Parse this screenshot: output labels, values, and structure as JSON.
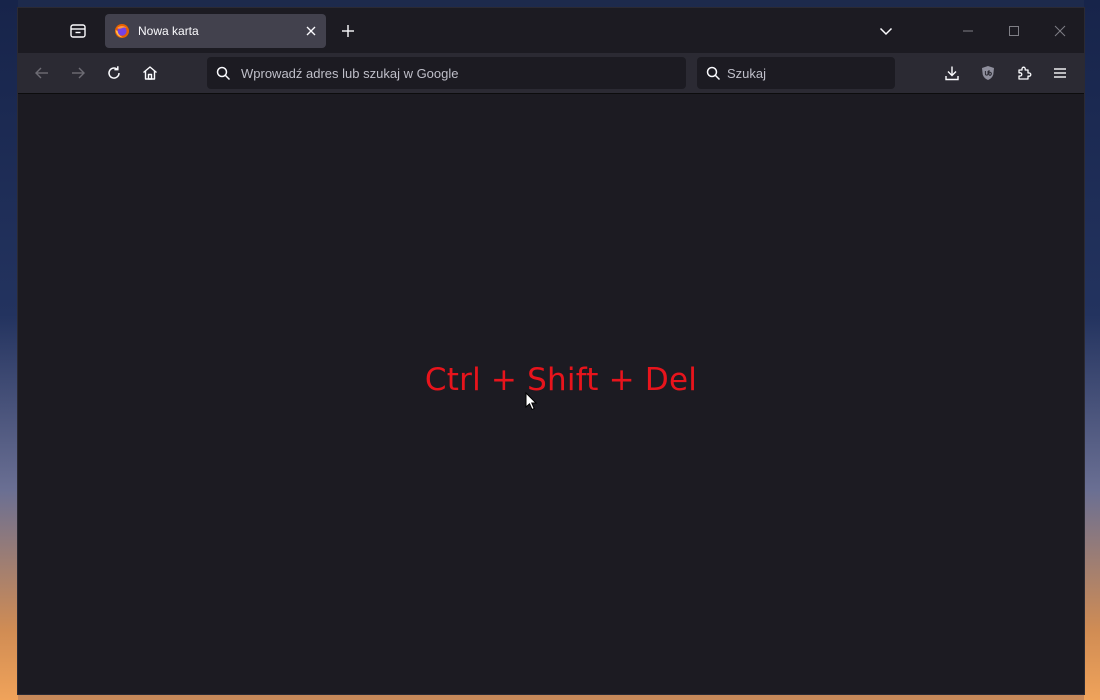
{
  "browser": {
    "tab": {
      "title": "Nowa karta"
    },
    "urlbar": {
      "placeholder": "Wprowadź adres lub szukaj w Google"
    },
    "searchbar": {
      "placeholder": "Szukaj"
    }
  },
  "content": {
    "hint_text": "Ctrl + Shift + Del"
  },
  "colors": {
    "titlebar_bg": "#1c1b22",
    "toolbar_bg": "#2b2a33",
    "tab_bg": "#42414d",
    "content_bg": "#1c1b22",
    "hint_text": "#e8141c"
  }
}
